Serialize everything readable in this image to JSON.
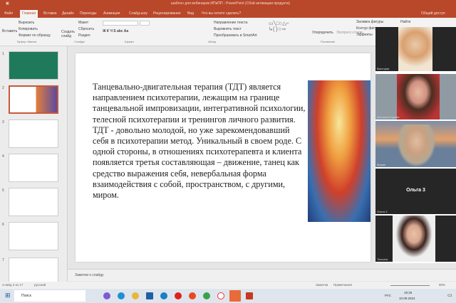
{
  "window": {
    "title": "шаблон для вебинаров ИПиПП - PowerPoint (Сбой активации продукта)",
    "share": "Общий доступ",
    "search_hint": "Что вы хотите сделать?"
  },
  "tabs": [
    "Файл",
    "Главная",
    "Вставка",
    "Дизайн",
    "Переходы",
    "Анимация",
    "Слайд-шоу",
    "Рецензирование",
    "Вид"
  ],
  "ribbon": {
    "paste": "Вставить",
    "cut": "Вырезать",
    "copy": "Копировать",
    "format_painter": "Формат по образцу",
    "clipboard": "Буфер обмена",
    "new_slide": "Создать слайд",
    "layout": "Макет",
    "reset": "Сбросить",
    "section": "Раздел",
    "slides": "Слайды",
    "font": "Шрифт",
    "paragraph": "Абзац",
    "text_direction": "Направление текста",
    "align_text": "Выровнять текст",
    "smartart": "Преобразовать в SmartArt",
    "arrange": "Упорядочить",
    "express_styles": "Экспресс-стили",
    "shape_fill": "Заливка фигуры",
    "shape_outline": "Контур фигуры",
    "shape_effects": "Эффекты",
    "drawing": "Рисование",
    "find": "Найти"
  },
  "thumbnails": [
    "1",
    "2",
    "3",
    "4",
    "5",
    "6",
    "7"
  ],
  "slide": {
    "text": "Танцевально-двигательная терапия (ТДТ) является направлением психотерапии, лежащим на границе танцевальной импровизации, интегративной психологии, телесной психотерапии и тренингов личного развития. ТДТ - довольно молодой, но уже зарекомендовавший себя в психотерапии метод. Уникальный в своем роде. С одной стороны, в отношениях психотерапевта и клиента появляется третья составляющая – движение, танец как средство выражения себя, невербальная форма взаимодействия с собой, пространством, с другими, миром."
  },
  "notes": "Заметки к слайду",
  "status": {
    "slide": "Слайд 2 из 17",
    "language": "русский",
    "notes": "Заметки",
    "comments": "Примечания",
    "zoom": "90%"
  },
  "taskbar": {
    "search": "Поиск",
    "time": "19:25",
    "date": "10.09.2024",
    "lang": "РУС"
  },
  "participants": [
    {
      "name": "Виктория"
    },
    {
      "name": "Антонина Гурова"
    },
    {
      "name": "Мария"
    },
    {
      "name": "Ольга 3",
      "label": "Ольга 3"
    },
    {
      "name": "Татьяна"
    }
  ]
}
